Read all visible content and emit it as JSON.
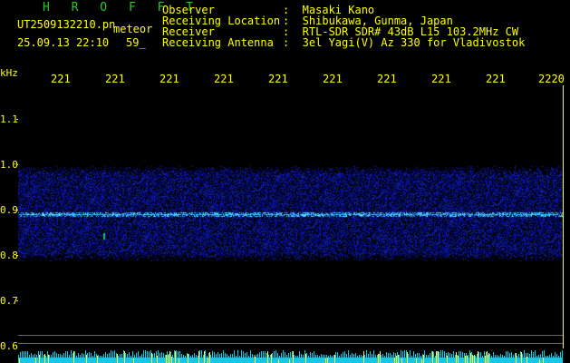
{
  "header": {
    "program": "H R O F F T",
    "file_name": "UT2509132210.pn",
    "mode": "meteor",
    "date_time": "25.09.13 22:10",
    "seconds": "59_"
  },
  "info": [
    {
      "label": "Observer",
      "value": ":  Masaki Kano"
    },
    {
      "label": "Receiving Location",
      "value": ":  Shibukawa, Gunma, Japan"
    },
    {
      "label": "Receiver",
      "value": ":  RTL-SDR SDR# 43dB L15 103.2MHz CW"
    },
    {
      "label": "Receiving Antenna",
      "value": ":  3el Yagi(V) Az 330 for Vladivostok"
    }
  ],
  "axis": {
    "y_unit": "kHz",
    "y_ticks": [
      "1.1",
      "1.0",
      "0.9",
      "0.8",
      "0.7",
      "0.6"
    ],
    "x_ticks": [
      "221",
      "221",
      "221",
      "221",
      "221",
      "221",
      "221",
      "221",
      "221",
      "2220"
    ]
  },
  "colors": {
    "background": "#000000",
    "text": "#ffff00",
    "title": "#22cc22",
    "noise": "#1e3cff",
    "signal": "#6fe8ff"
  }
}
